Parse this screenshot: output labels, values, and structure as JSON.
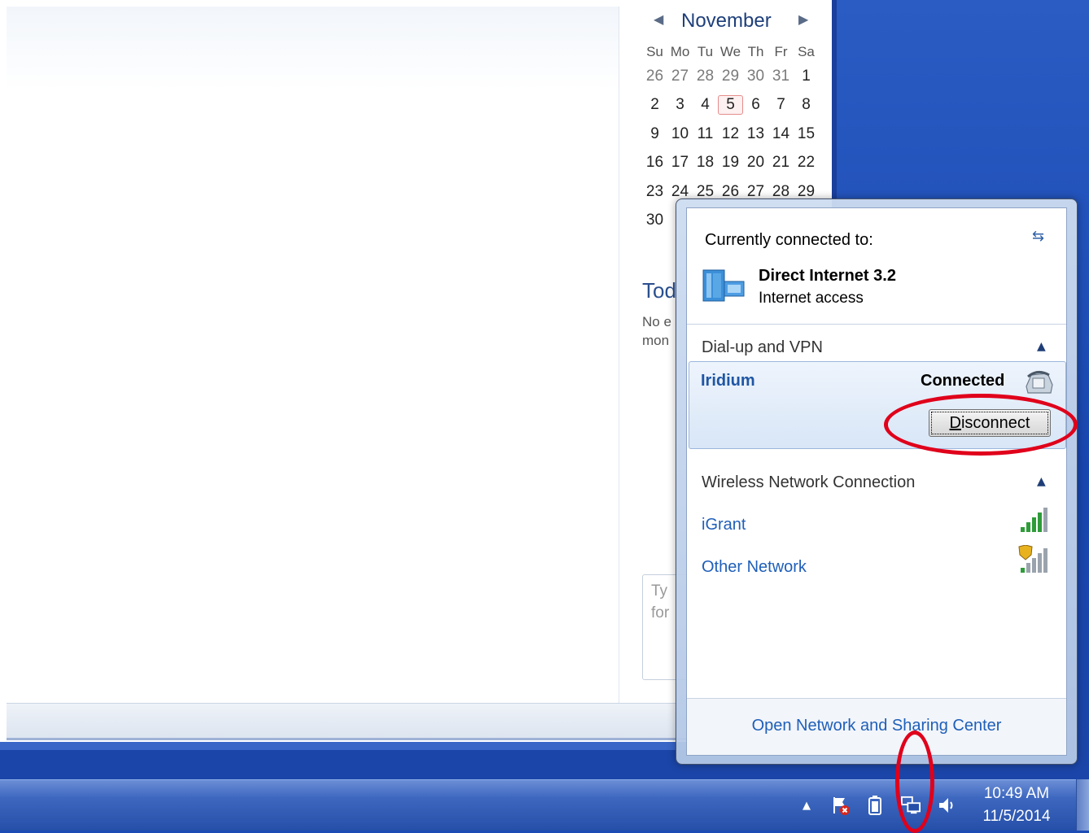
{
  "calendar": {
    "month": "November",
    "days_of_week": [
      "Su",
      "Mo",
      "Tu",
      "We",
      "Th",
      "Fr",
      "Sa"
    ],
    "weeks": [
      [
        "26",
        "27",
        "28",
        "29",
        "30",
        "31",
        "1"
      ],
      [
        "2",
        "3",
        "4",
        "5",
        "6",
        "7",
        "8"
      ],
      [
        "9",
        "10",
        "11",
        "12",
        "13",
        "14",
        "15"
      ],
      [
        "16",
        "17",
        "18",
        "19",
        "20",
        "21",
        "22"
      ],
      [
        "23",
        "24",
        "25",
        "26",
        "27",
        "28",
        "29"
      ],
      [
        "30",
        "",
        "",
        "",
        "",
        "",
        ""
      ]
    ],
    "today": "5"
  },
  "todo": {
    "heading": "Tod",
    "text_line1": "No e",
    "text_line2": "mon",
    "input_placeholder_line1": "Ty",
    "input_placeholder_line2": "for"
  },
  "network_flyout": {
    "currently_connected_label": "Currently connected to:",
    "current_network_name": "Direct Internet 3.2",
    "current_network_access": "Internet access",
    "dialup_section_title": "Dial-up and VPN",
    "vpn_name": "Iridium",
    "vpn_status": "Connected",
    "disconnect_label": "Disconnect",
    "wireless_section_title": "Wireless Network Connection",
    "wifi_networks": [
      "iGrant",
      "Other Network"
    ],
    "footer_link": "Open Network and Sharing Center"
  },
  "taskbar": {
    "time": "10:49 AM",
    "date": "11/5/2014",
    "tray_icons": [
      "show-hidden-icons",
      "action-center-flag-icon",
      "battery-icon",
      "network-icon",
      "volume-icon"
    ]
  },
  "colors": {
    "link_blue": "#1f5fb8",
    "annotation_red": "#e0001b",
    "taskbar_blue": "#254fa8"
  }
}
